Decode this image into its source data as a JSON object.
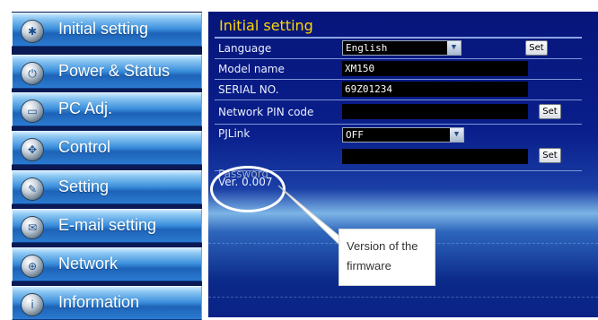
{
  "nav": {
    "items": [
      {
        "label": "Initial setting",
        "icon": "settings-icon"
      },
      {
        "label": "Power & Status",
        "icon": "power-icon"
      },
      {
        "label": "PC Adj.",
        "icon": "monitor-icon"
      },
      {
        "label": "Control",
        "icon": "directional-pad-icon"
      },
      {
        "label": "Setting",
        "icon": "wrench-icon"
      },
      {
        "label": "E-mail setting",
        "icon": "envelope-icon"
      },
      {
        "label": "Network",
        "icon": "network-icon"
      },
      {
        "label": "Information",
        "icon": "info-icon"
      }
    ]
  },
  "main": {
    "title": "Initial setting",
    "language": {
      "label": "Language",
      "value": "English",
      "set_label": "Set"
    },
    "model_name": {
      "label": "Model name",
      "value": "XM150"
    },
    "serial_no": {
      "label": "SERIAL NO.",
      "value": "69Z01234"
    },
    "network_pin": {
      "label": "Network PIN code",
      "value": "",
      "set_label": "Set"
    },
    "pjlink": {
      "label": "PJLink",
      "value": "OFF"
    },
    "password": {
      "label": "Password",
      "value": "",
      "set_label": "Set"
    },
    "version": "Ver. 0.007"
  },
  "callout": {
    "line1": "Version of the",
    "line2": "firmware"
  },
  "colors": {
    "title_yellow": "#ffd800",
    "panel_blue": "#0a1f8c",
    "nav_blue": "#2a7bd0"
  }
}
